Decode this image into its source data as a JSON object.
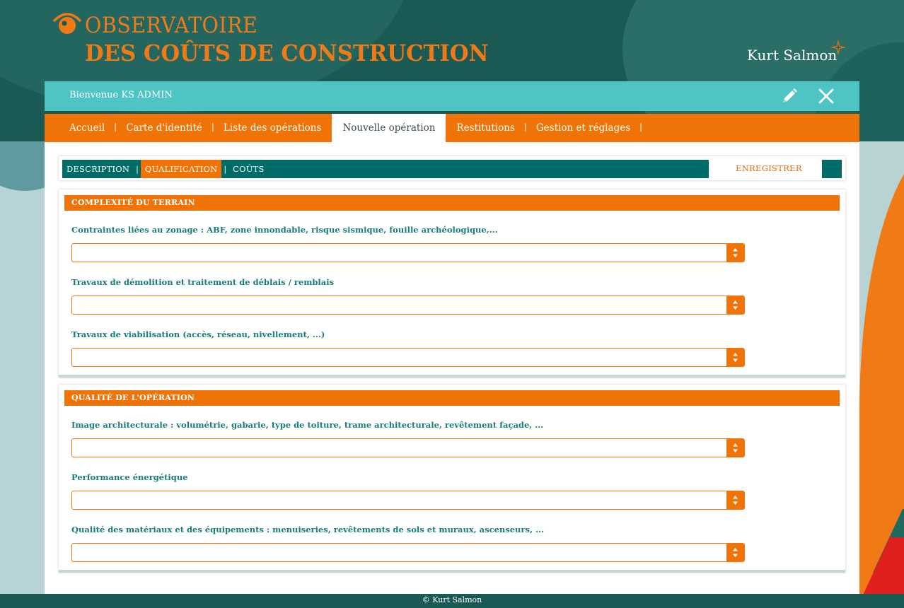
{
  "logo": {
    "line1": "OBSERVATOIRE",
    "line2": "DES COÛTS DE CONSTRUCTION",
    "icon": "eye-logo-icon"
  },
  "brand": {
    "name": "Kurt Salmon",
    "icon": "star-logo-icon"
  },
  "header": {
    "welcome": "Bienvenue KS ADMIN",
    "edit_icon": "pencil-icon",
    "close_icon": "close-icon"
  },
  "nav": {
    "items": [
      {
        "label": "Accueil"
      },
      {
        "label": "Carte d'identité"
      },
      {
        "label": "Liste des opérations"
      },
      {
        "label": "Nouvelle opération"
      },
      {
        "label": "Restitutions"
      },
      {
        "label": "Gestion et réglages"
      }
    ],
    "active": "Nouvelle opération"
  },
  "subnav": {
    "tabs": [
      {
        "label": "DESCRIPTION"
      },
      {
        "label": "QUALIFICATION"
      },
      {
        "label": "COÛTS"
      }
    ],
    "active": "QUALIFICATION",
    "save_label": "ENREGISTRER"
  },
  "sections": [
    {
      "title": "COMPLEXITÉ DU TERRAIN",
      "fields": [
        {
          "label": "Contraintes liées au zonage : ABF, zone innondable, risque sismique, fouille archéologique,...",
          "value": ""
        },
        {
          "label": "Travaux de démolition et traitement de déblais / remblais",
          "value": ""
        },
        {
          "label": "Travaux de viabilisation (accès, réseau, nivellement, ...)",
          "value": ""
        }
      ]
    },
    {
      "title": "QUALITÉ DE L'OPÉRATION",
      "fields": [
        {
          "label": "Image architecturale : volumétrie, gabarie, type de toiture, trame architecturale, revêtement façade, ...",
          "value": ""
        },
        {
          "label": "Performance énergétique",
          "value": ""
        },
        {
          "label": "Qualité des matériaux et des équipements : menuiseries, revêtements de sols et muraux, ascenseurs, ...",
          "value": ""
        }
      ]
    }
  ],
  "footer": {
    "text": "© Kurt Salmon"
  },
  "colors": {
    "orange": "#f07307",
    "teal_dark": "#006b67",
    "teal_light": "#4fc4c5",
    "label_teal": "#157d7a",
    "bg_dark": "#1b5a54"
  }
}
